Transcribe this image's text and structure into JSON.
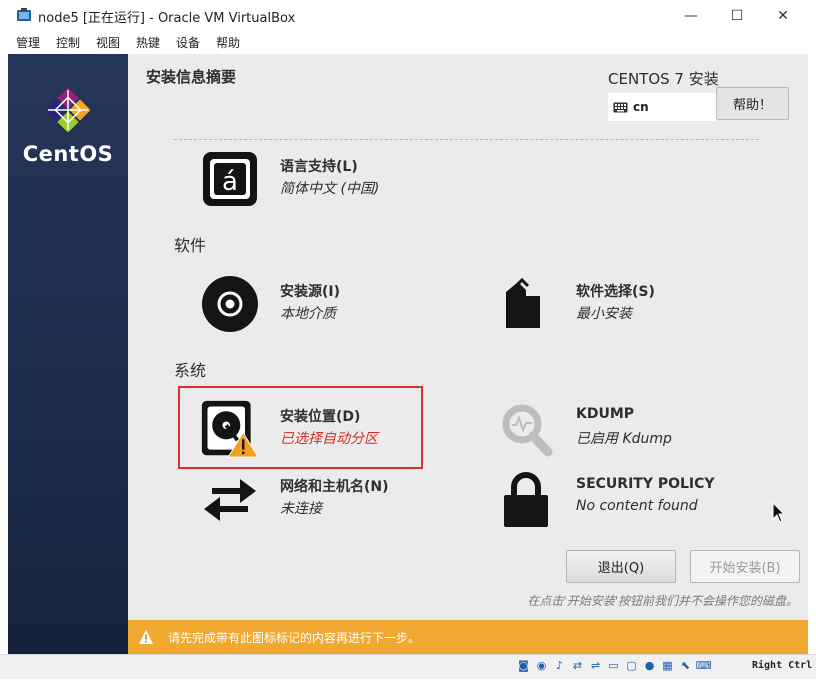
{
  "window": {
    "title": "node5 [正在运行] - Oracle VM VirtualBox",
    "minimize_glyph": "—",
    "maximize_glyph": "☐",
    "close_glyph": "✕"
  },
  "menu": [
    "管理",
    "控制",
    "视图",
    "热键",
    "设备",
    "帮助"
  ],
  "brand": {
    "name": "CentOS"
  },
  "hub": {
    "title": "安装信息摘要",
    "product": "CENTOS 7 安装",
    "keyboard_layout": "cn",
    "help_button": "帮助！"
  },
  "sections": {
    "software": "软件",
    "system": "系统"
  },
  "spokes": {
    "language": {
      "name": "语言支持(L)",
      "status": "简体中文 (中国)"
    },
    "source": {
      "name": "安装源(I)",
      "status": "本地介质"
    },
    "software_selection": {
      "name": "软件选择(S)",
      "status": "最小安装"
    },
    "destination": {
      "name": "安装位置(D)",
      "status": "已选择自动分区"
    },
    "kdump": {
      "name": "KDUMP",
      "status": "已启用 Kdump"
    },
    "network": {
      "name": "网络和主机名(N)",
      "status": "未连接"
    },
    "security": {
      "name": "SECURITY POLICY",
      "status": "No content found"
    }
  },
  "buttons": {
    "quit": "退出(Q)",
    "begin": "开始安装(B)"
  },
  "hint": "在点击'开始安装'按钮前我们并不会操作您的磁盘。",
  "warning_bar": "请先完成带有此图标标记的内容再进行下一步。",
  "statusbar": {
    "host_key": "Right Ctrl"
  },
  "colors": {
    "sidebar": "#1d2d4e",
    "warning_bar": "#f0a830",
    "warning_text": "#d0302b",
    "highlight_box": "#d9312b"
  }
}
